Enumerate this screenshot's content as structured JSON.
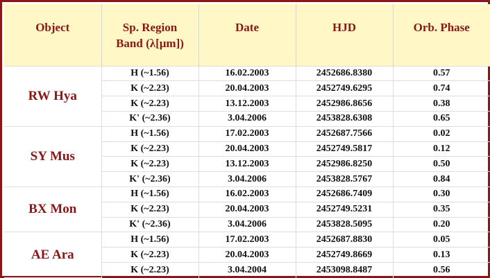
{
  "headers": {
    "object": "Object",
    "band_line1": "Sp. Region",
    "band_line2": "Band (λ[μm])",
    "date": "Date",
    "hjd": "HJD",
    "phase": "Orb. Phase"
  },
  "groups": [
    {
      "object": "RW Hya",
      "rows": [
        {
          "band": "H (~1.56)",
          "date": "16.02.2003",
          "hjd": "2452686.8380",
          "phase": "0.57"
        },
        {
          "band": "K (~2.23)",
          "date": "20.04.2003",
          "hjd": "2452749.6295",
          "phase": "0.74"
        },
        {
          "band": "K (~2.23)",
          "date": "13.12.2003",
          "hjd": "2452986.8656",
          "phase": "0.38"
        },
        {
          "band": "K' (~2.36)",
          "date": "3.04.2006",
          "hjd": "2453828.6308",
          "phase": "0.65"
        }
      ]
    },
    {
      "object": "SY Mus",
      "rows": [
        {
          "band": "H (~1.56)",
          "date": "17.02.2003",
          "hjd": "2452687.7566",
          "phase": "0.02"
        },
        {
          "band": "K (~2.23)",
          "date": "20.04.2003",
          "hjd": "2452749.5817",
          "phase": "0.12"
        },
        {
          "band": "K (~2.23)",
          "date": "13.12.2003",
          "hjd": "2452986.8250",
          "phase": "0.50"
        },
        {
          "band": "K' (~2.36)",
          "date": "3.04.2006",
          "hjd": "2453828.5767",
          "phase": "0.84"
        }
      ]
    },
    {
      "object": "BX Mon",
      "rows": [
        {
          "band": "H (~1.56)",
          "date": "16.02.2003",
          "hjd": "2452686.7409",
          "phase": "0.30"
        },
        {
          "band": "K (~2.23)",
          "date": "20.04.2003",
          "hjd": "2452749.5231",
          "phase": "0.35"
        },
        {
          "band": "K' (~2.36)",
          "date": "3.04.2006",
          "hjd": "2453828.5095",
          "phase": "0.20"
        }
      ]
    },
    {
      "object": "AE Ara",
      "rows": [
        {
          "band": "H (~1.56)",
          "date": "17.02.2003",
          "hjd": "2452687.8830",
          "phase": "0.05"
        },
        {
          "band": "K (~2.23)",
          "date": "20.04.2003",
          "hjd": "2452749.8669",
          "phase": "0.13"
        },
        {
          "band": "K (~2.23)",
          "date": "3.04.2004",
          "hjd": "2453098.8487",
          "phase": "0.56"
        }
      ]
    }
  ]
}
